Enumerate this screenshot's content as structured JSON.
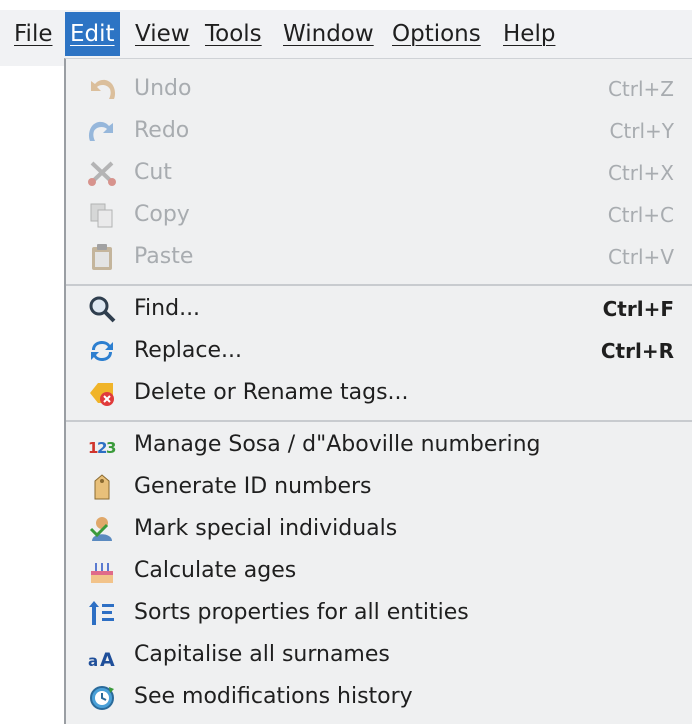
{
  "menubar": {
    "items": [
      {
        "label": "File"
      },
      {
        "label": "Edit"
      },
      {
        "label": "View"
      },
      {
        "label": "Tools"
      },
      {
        "label": "Window"
      },
      {
        "label": "Options"
      },
      {
        "label": "Help"
      }
    ],
    "active": "Edit",
    "accent": "#2d74c4"
  },
  "edit_menu": {
    "undo": {
      "label": "Undo",
      "shortcut": "Ctrl+Z",
      "icon": "undo-icon",
      "enabled": false
    },
    "redo": {
      "label": "Redo",
      "shortcut": "Ctrl+Y",
      "icon": "redo-icon",
      "enabled": false
    },
    "cut": {
      "label": "Cut",
      "shortcut": "Ctrl+X",
      "icon": "scissors-icon",
      "enabled": false
    },
    "copy": {
      "label": "Copy",
      "shortcut": "Ctrl+C",
      "icon": "copy-icon",
      "enabled": false
    },
    "paste": {
      "label": "Paste",
      "shortcut": "Ctrl+V",
      "icon": "clipboard-icon",
      "enabled": false
    },
    "find": {
      "label": "Find...",
      "shortcut": "Ctrl+F",
      "icon": "magnifier-icon",
      "enabled": true
    },
    "replace": {
      "label": "Replace...",
      "shortcut": "Ctrl+R",
      "icon": "replace-arrows-icon",
      "enabled": true
    },
    "delete_tags": {
      "label": "Delete or Rename tags...",
      "icon": "tag-delete-icon",
      "enabled": true
    },
    "sosa": {
      "label": "Manage Sosa / d\"Aboville numbering",
      "icon": "numbering-icon",
      "enabled": true
    },
    "gen_ids": {
      "label": "Generate ID numbers",
      "icon": "id-tag-icon",
      "enabled": true
    },
    "mark_special": {
      "label": "Mark special individuals",
      "icon": "person-mark-icon",
      "enabled": true
    },
    "calc_ages": {
      "label": "Calculate ages",
      "icon": "birthday-cake-icon",
      "enabled": true
    },
    "sort_props": {
      "label": "Sorts properties for all entities",
      "icon": "sort-icon",
      "enabled": true
    },
    "capitalise": {
      "label": "Capitalise all surnames",
      "icon": "capitalise-icon",
      "enabled": true
    },
    "history": {
      "label": "See modifications history",
      "icon": "history-icon",
      "enabled": true
    }
  }
}
